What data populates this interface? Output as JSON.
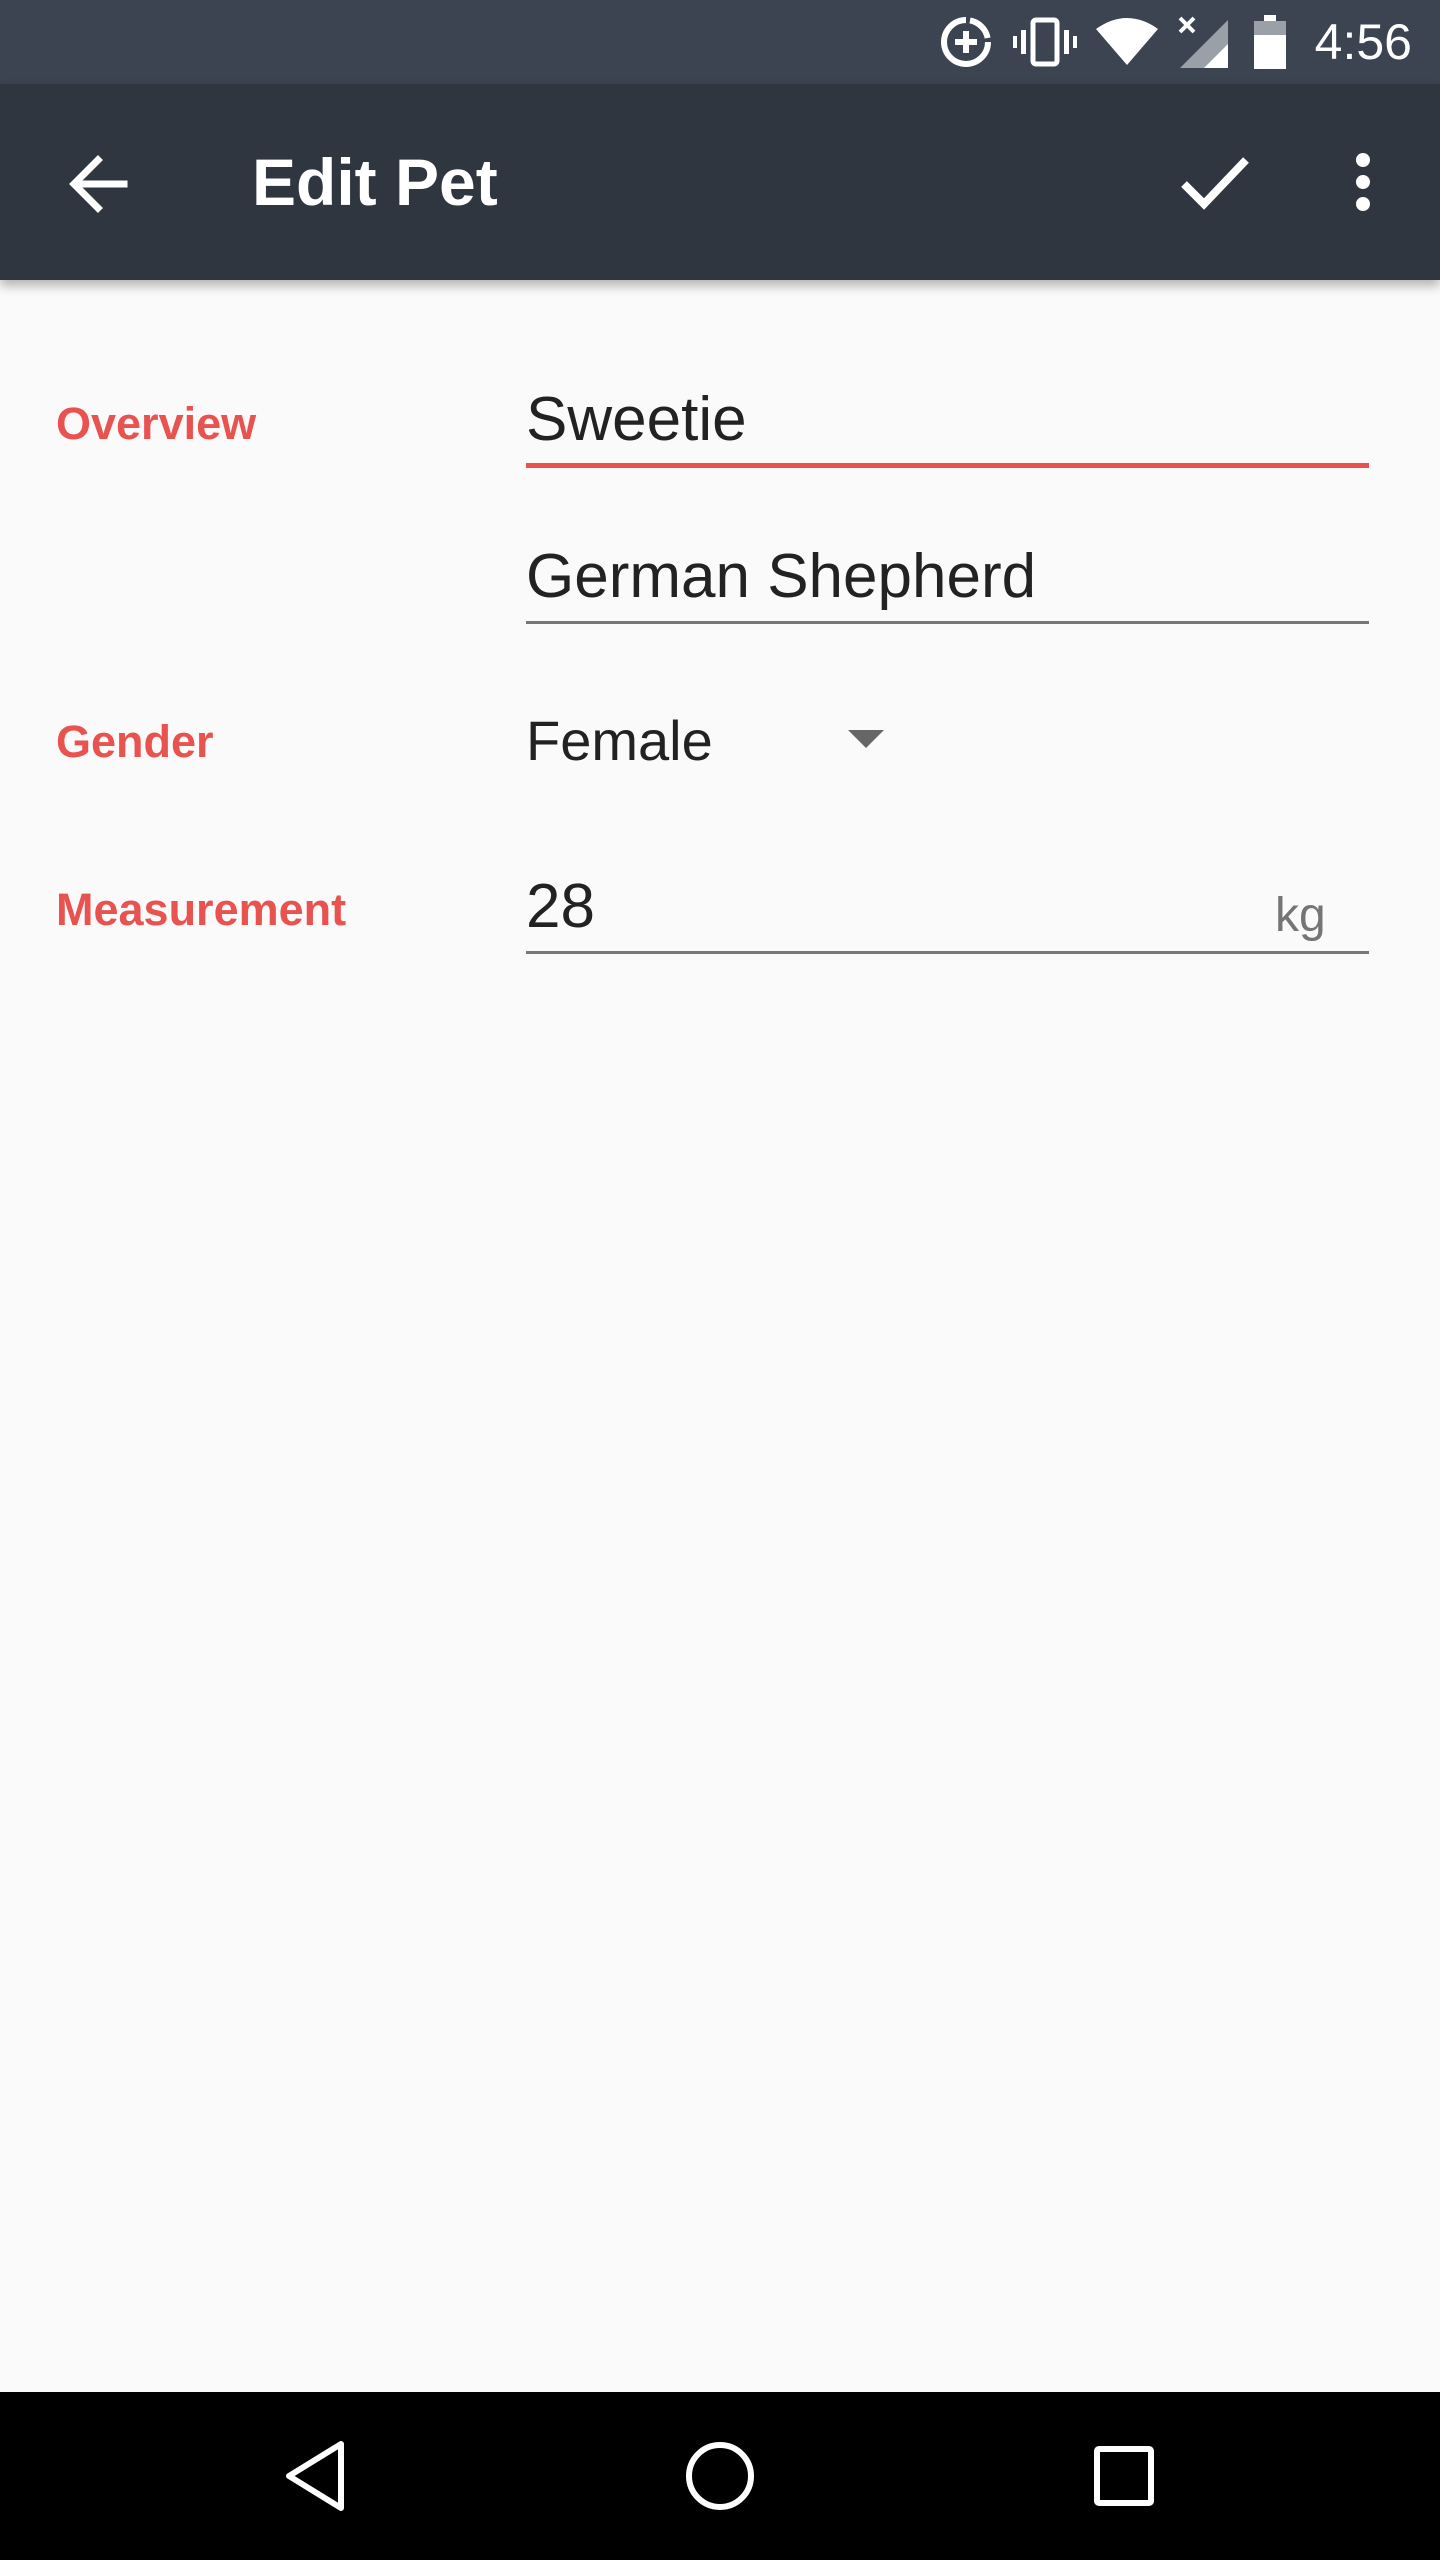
{
  "status_bar": {
    "time": "4:56",
    "icons": [
      "data-saver-icon",
      "vibrate-icon",
      "wifi-icon",
      "signal-off-icon",
      "battery-icon"
    ]
  },
  "app_bar": {
    "title": "Edit Pet",
    "icons": {
      "back": "arrow-back-icon",
      "save": "check-icon",
      "more": "more-vert-icon"
    }
  },
  "form": {
    "overview": {
      "label": "Overview",
      "name_value": "Sweetie",
      "breed_value": "German Shepherd"
    },
    "gender": {
      "label": "Gender",
      "value": "Female"
    },
    "measurement": {
      "label": "Measurement",
      "value": "28",
      "unit": "kg"
    }
  },
  "colors": {
    "accent": "#e8524f",
    "app_bar": "#2f3640",
    "status_bar": "#3b4450",
    "background": "#fafafa"
  },
  "nav_bar": {
    "icons": [
      "nav-back-icon",
      "nav-home-icon",
      "nav-recents-icon"
    ]
  }
}
